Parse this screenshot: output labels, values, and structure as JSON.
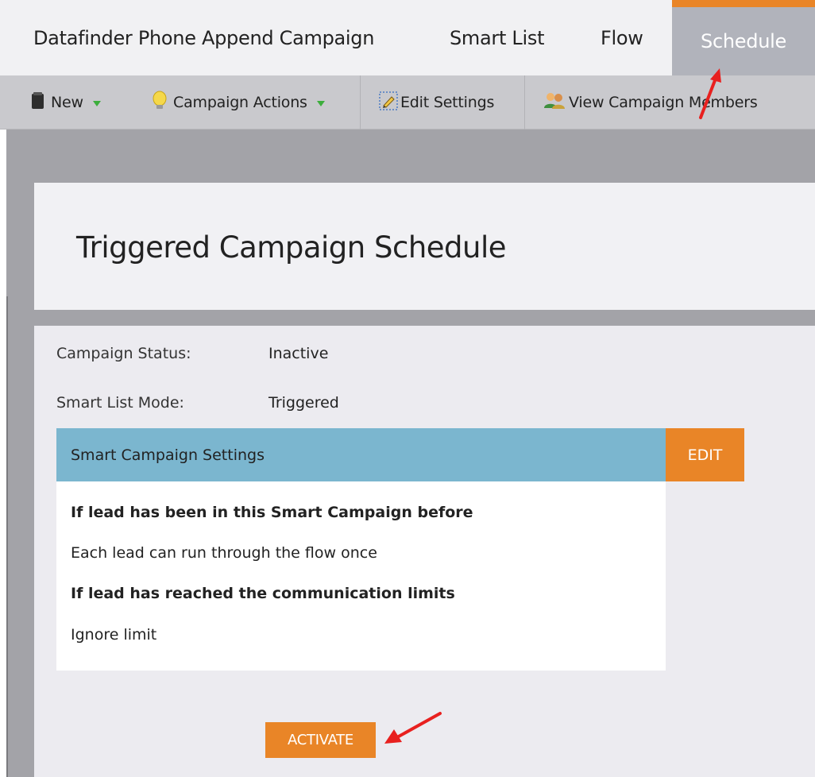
{
  "tabs": {
    "campaign_name": "Datafinder Phone Append Campaign",
    "smart_list": "Smart List",
    "flow": "Flow",
    "schedule": "Schedule",
    "active": "Schedule"
  },
  "toolbar": {
    "new_label": "New",
    "campaign_actions_label": "Campaign Actions",
    "edit_settings_label": "Edit Settings",
    "view_members_label": "View Campaign Members"
  },
  "page": {
    "title": "Triggered Campaign Schedule"
  },
  "status": {
    "campaign_status_label": "Campaign Status:",
    "campaign_status_value": "Inactive",
    "smart_list_mode_label": "Smart List Mode:",
    "smart_list_mode_value": "Triggered"
  },
  "settings": {
    "header": "Smart Campaign Settings",
    "edit_label": "EDIT",
    "qualification_heading": "If lead has been in this Smart Campaign before",
    "qualification_value": "Each lead can run through the flow once",
    "limits_heading": "If lead has reached the communication limits",
    "limits_value": "Ignore limit"
  },
  "actions": {
    "activate_label": "ACTIVATE"
  },
  "colors": {
    "accent_orange": "#e98527",
    "settings_header_blue": "#7bb6cf",
    "annotation_red": "#e8201f",
    "dropdown_green": "#3cae3c"
  },
  "icons": {
    "new": "page-icon",
    "campaign_actions": "lightbulb-icon",
    "edit_settings": "pencil-icon",
    "view_members": "people-icon"
  }
}
